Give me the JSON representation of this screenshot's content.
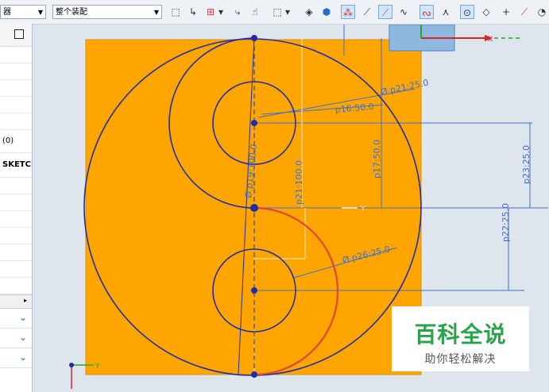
{
  "toolbar": {
    "filter_combo": "器",
    "assembly_combo": "整个装配"
  },
  "navigator": {
    "rows": [
      "",
      "",
      "",
      "",
      "",
      "(0)",
      "SKETCH",
      "",
      "",
      "",
      "",
      "",
      "",
      ""
    ]
  },
  "sketch": {
    "dimensions": {
      "p21": "Ø p21:25.0",
      "p16": "p16:50.0",
      "p17": "p17:50.0",
      "p23": "p23:25.0",
      "p19": "Ø p19:100.0",
      "p21_line": "p21:100.0",
      "p22": "p22:25.0",
      "p26": "Ø p26:25.0"
    },
    "axis_labels": {
      "y_mid": "Y",
      "x_top": "X",
      "y_corner": "Y"
    },
    "colors": {
      "sheet": "#ffa500",
      "curve": "#1f2fa3",
      "active_curve": "#e0453a",
      "dim": "#3d6fd1"
    }
  },
  "watermark": {
    "title": "百科全说",
    "subtitle": "助你轻松解决"
  }
}
